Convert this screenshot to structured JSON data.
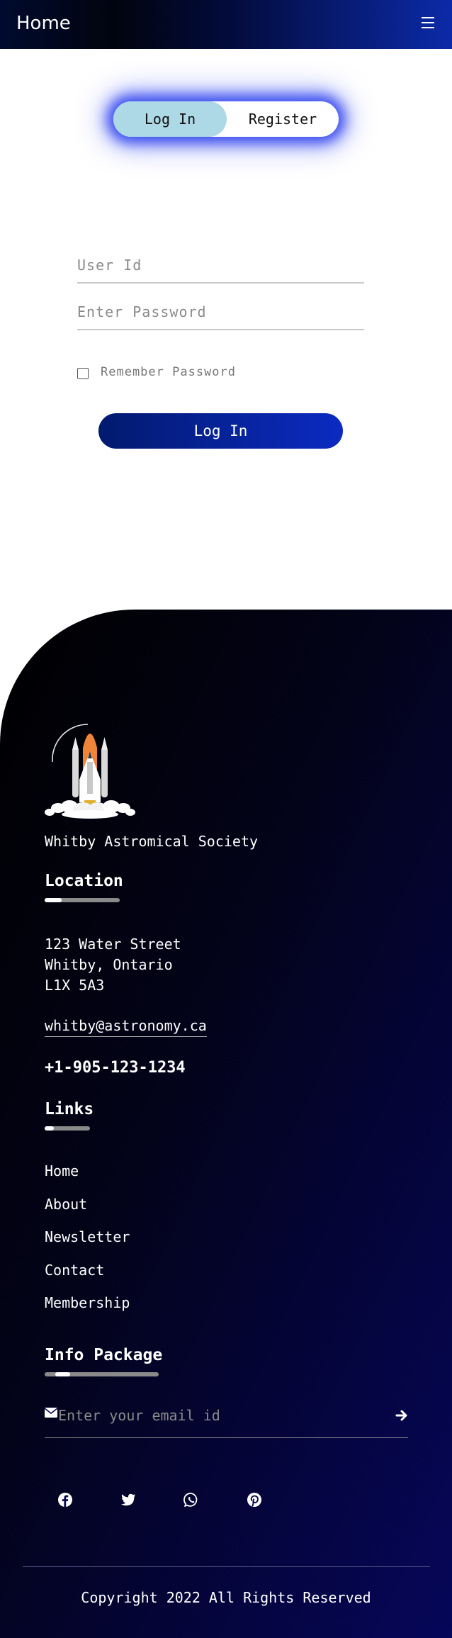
{
  "header": {
    "brand": "Home",
    "menu_icon": "hamburger-menu-icon"
  },
  "auth_toggle": {
    "login_label": "Log In",
    "register_label": "Register",
    "active": "Log In"
  },
  "form": {
    "user_id_placeholder": "User Id",
    "password_placeholder": "Enter Password",
    "remember_label": "Remember Password",
    "remember_checked": false,
    "submit_label": "Log In"
  },
  "footer": {
    "logo_icon": "space-shuttle-launch-icon",
    "org_name": "Whitby Astromical Society",
    "location": {
      "heading": "Location",
      "address_lines": [
        "123 Water Street",
        "Whitby, Ontario",
        "L1X 5A3"
      ],
      "email": "whitby@astronomy.ca",
      "phone": "+1-905-123-1234"
    },
    "links": {
      "heading": "Links",
      "items": [
        "Home",
        "About",
        "Newsletter",
        "Contact",
        "Membership"
      ]
    },
    "info_package": {
      "heading": "Info Package",
      "email_placeholder": "Enter your email id",
      "email_icon": "envelope-icon",
      "submit_icon": "arrow-right-icon"
    },
    "social_icons": [
      "facebook-icon",
      "twitter-icon",
      "whatsapp-icon",
      "pinterest-icon"
    ],
    "copyright": "Copyright 2022 All Rights Reserved"
  },
  "colors": {
    "accent_blue": "#0b2bc2",
    "toggle_active": "#add8e6",
    "glow": "#3a4cf0",
    "footer_dark": "#000000",
    "footer_navy": "#06065a"
  }
}
